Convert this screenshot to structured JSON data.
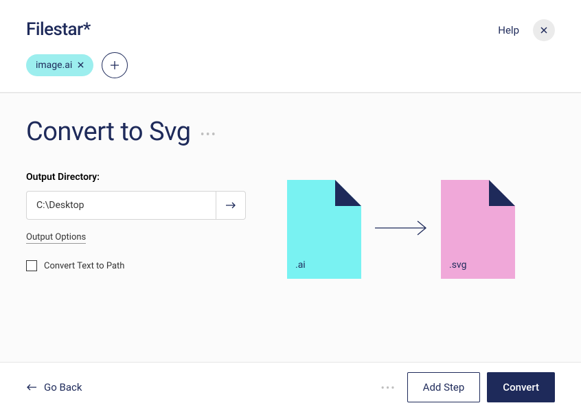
{
  "header": {
    "logo": "Filestar*",
    "help_label": "Help"
  },
  "files": {
    "chip_label": "image.ai"
  },
  "main": {
    "title": "Convert to Svg",
    "output_dir_label": "Output Directory:",
    "output_dir_value": "C:\\Desktop",
    "output_options_label": "Output Options",
    "checkbox_label": "Convert Text to Path"
  },
  "illustration": {
    "source_ext": ".ai",
    "target_ext": ".svg"
  },
  "footer": {
    "go_back_label": "Go Back",
    "add_step_label": "Add Step",
    "convert_label": "Convert"
  }
}
